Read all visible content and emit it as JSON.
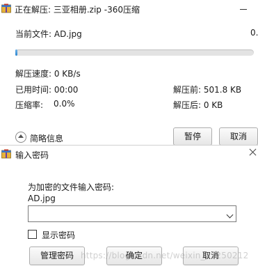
{
  "main_window": {
    "title": "正在解压: 三亚相册.zip -360压缩",
    "current_file_label": "当前文件: AD.jpg",
    "current_file_percent": "0.",
    "progress_fraction": 0.01,
    "speed_label": "解压速度: 0 KB/s",
    "elapsed_label": "已用时间: 00:00",
    "before_size_label": "解压前: 501.8 KB",
    "ratio_label": "压缩率:",
    "ratio_value": "0.0%",
    "after_size_label": "解压后: 0 KB",
    "brief_info_label": "简略信息",
    "pause_button": "暂停",
    "cancel_button": "取消"
  },
  "password_dialog": {
    "title": "输入密码",
    "prompt": "为加密的文件输入密码:",
    "filename": "AD.jpg",
    "password_value": "",
    "show_password_label": "显示密码",
    "manage_button": "管理密码",
    "ok_button": "确定",
    "cancel_button": "取消"
  },
  "watermark": "https://blog.csdn.net/weixin_41250212",
  "colors": {
    "progress_fill": "#2d86cf",
    "progress_track": "#e3e3e3",
    "button_border": "#adadad"
  }
}
